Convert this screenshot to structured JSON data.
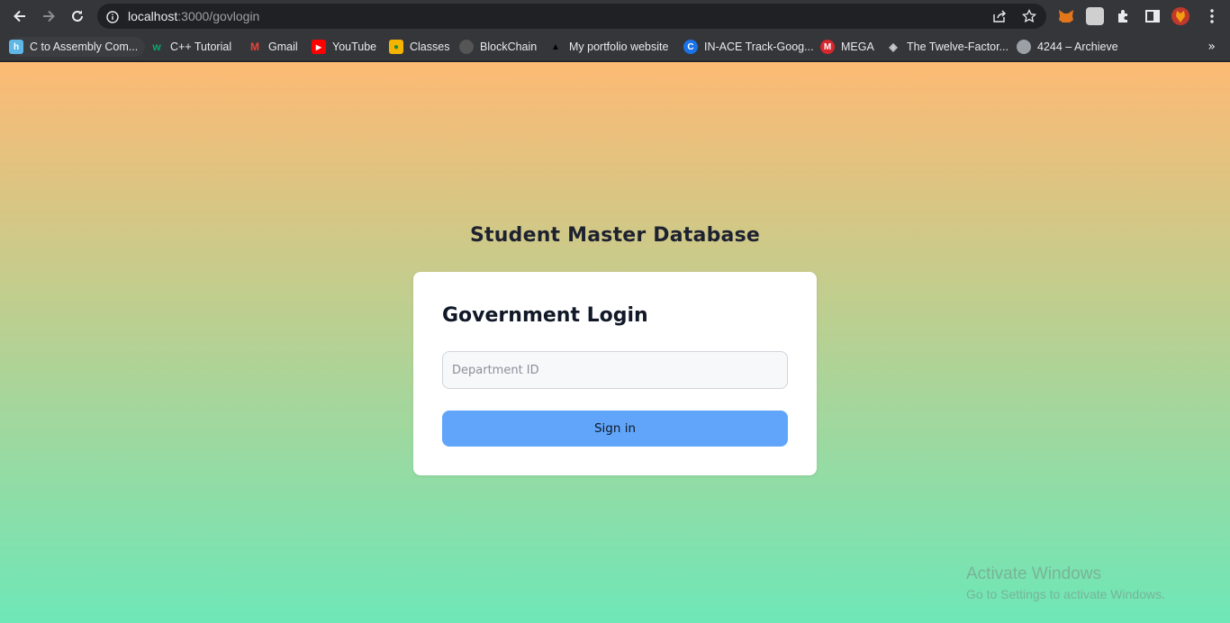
{
  "browser": {
    "url_host": "localhost",
    "url_path": ":3000/govlogin",
    "accent": "#202124"
  },
  "bookmarks": [
    {
      "label": "C to Assembly Com...",
      "icon": "hackerrank-h-icon",
      "color": "#5fb7e5"
    },
    {
      "label": "C++ Tutorial",
      "icon": "w3-w-icon",
      "color": "#04aa6d"
    },
    {
      "label": "Gmail",
      "icon": "gmail-icon",
      "color": "#ea4335"
    },
    {
      "label": "YouTube",
      "icon": "youtube-icon",
      "color": "#ff0000"
    },
    {
      "label": "Classes",
      "icon": "classroom-icon",
      "color": "#f4b400"
    },
    {
      "label": "BlockChain",
      "icon": "github-icon",
      "color": "#24292e"
    },
    {
      "label": "My portfolio website",
      "icon": "triangle-icon",
      "color": "#000000"
    },
    {
      "label": "IN-ACE Track-Goog...",
      "icon": "c-circle-icon",
      "color": "#1a73e8"
    },
    {
      "label": "MEGA",
      "icon": "mega-icon",
      "color": "#d9272e"
    },
    {
      "label": "The Twelve-Factor...",
      "icon": "diamond-layers-icon",
      "color": "#cccccc"
    },
    {
      "label": "4244 – Archieve",
      "icon": "globe-icon",
      "color": "#9aa0a6"
    }
  ],
  "page": {
    "title": "Student Master Database",
    "card_title": "Government Login",
    "input_placeholder": "Department ID",
    "input_value": "",
    "button_label": "Sign in",
    "button_color": "#60a5fa"
  },
  "watermark": {
    "line1": "Activate Windows",
    "line2": "Go to Settings to activate Windows."
  }
}
